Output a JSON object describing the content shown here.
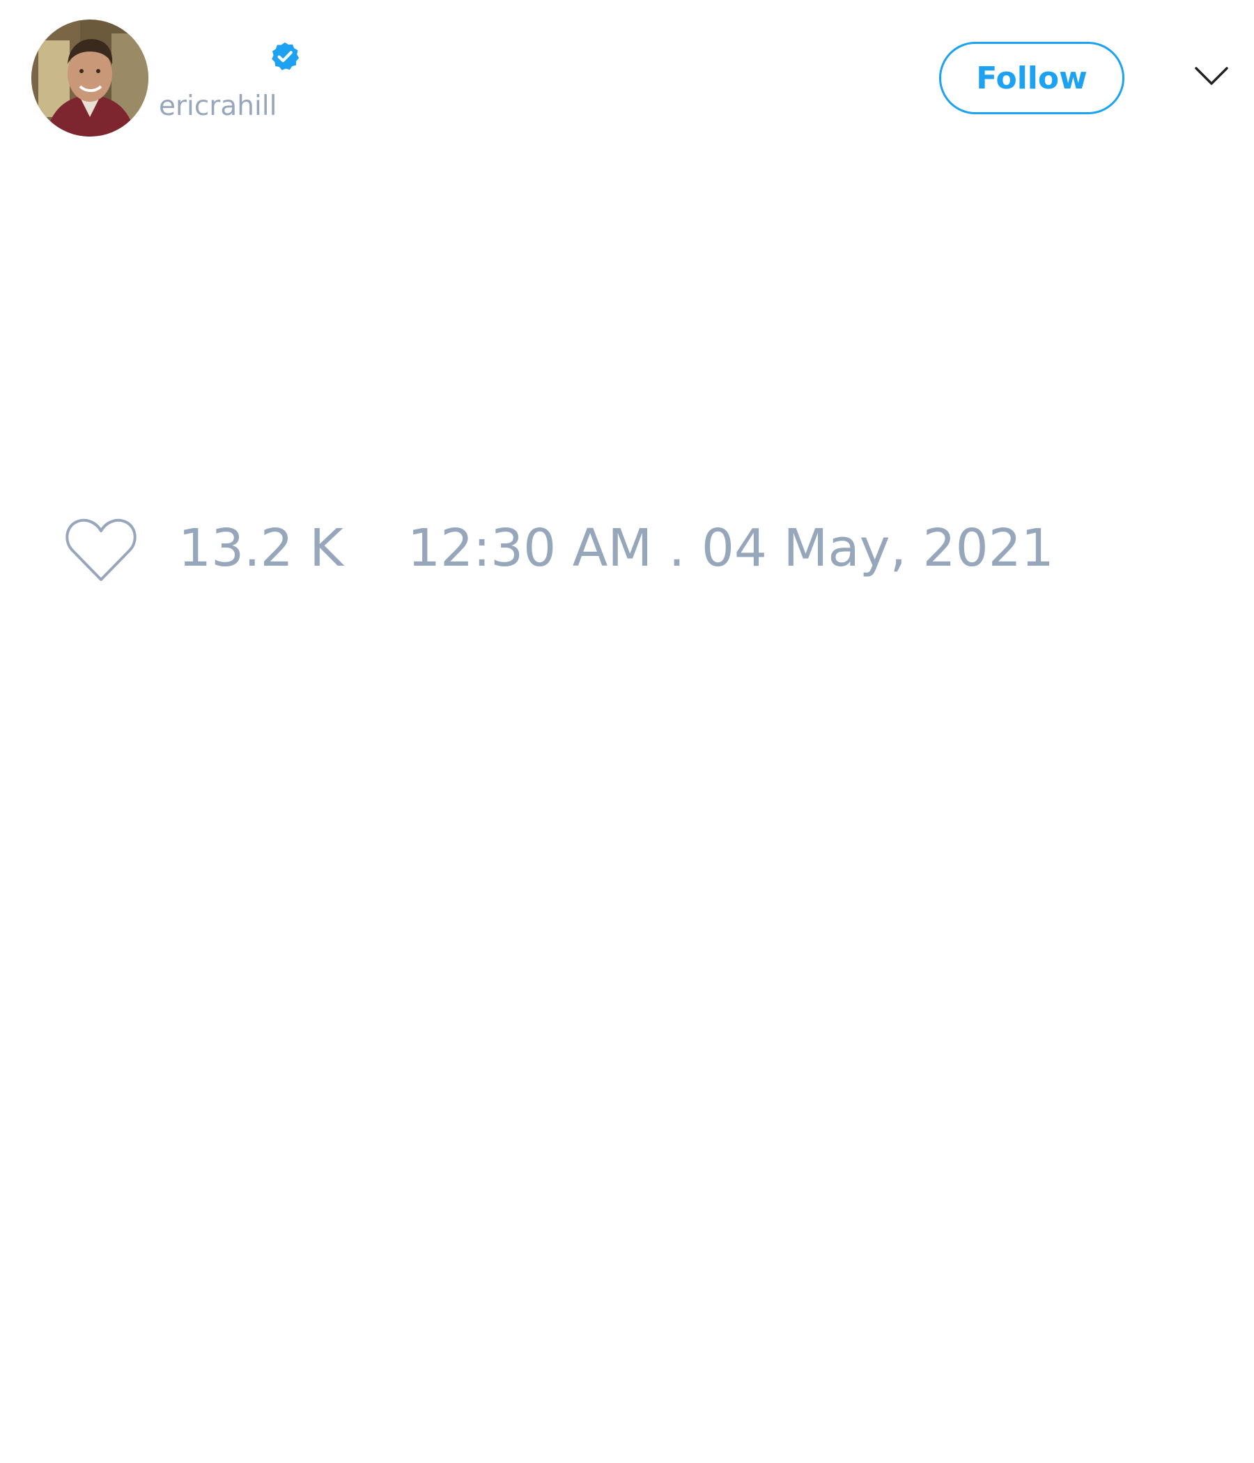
{
  "user": {
    "handle": "ericrahill",
    "verified": true,
    "avatar": "profile-photo"
  },
  "actions": {
    "follow_label": "Follow",
    "more_icon": "chevron-down-icon"
  },
  "tweet": {
    "like_icon": "heart-outline-icon",
    "likes": "13.2 K",
    "timestamp": "12:30 AM . 04 May, 2021"
  },
  "colors": {
    "accent": "#1da1f2",
    "muted_text": "#96a6bb",
    "background": "#ffffff"
  }
}
